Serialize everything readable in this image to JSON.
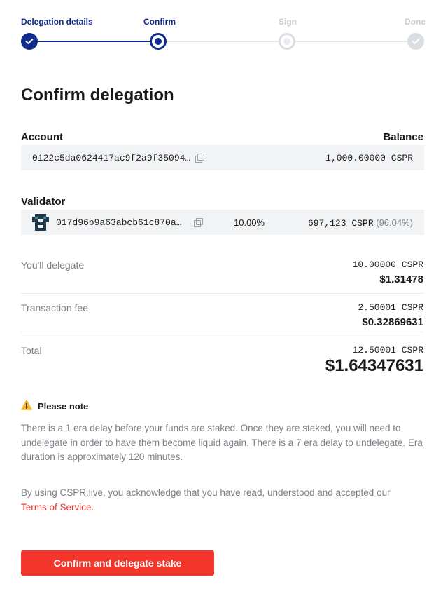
{
  "stepper": {
    "steps": [
      {
        "label": "Delegation details",
        "state": "complete"
      },
      {
        "label": "Confirm",
        "state": "current"
      },
      {
        "label": "Sign",
        "state": "pending"
      },
      {
        "label": "Done",
        "state": "pending"
      }
    ]
  },
  "page_title": "Confirm delegation",
  "account": {
    "label": "Account",
    "balance_label": "Balance",
    "public_key": "0122c5da0624417ac9f2a9f35094…",
    "balance": "1,000.00000 CSPR"
  },
  "validator": {
    "label": "Validator",
    "public_key": "017d96b9a63abcb61c870a…",
    "fee": "10.00%",
    "stake": "697,123 CSPR",
    "stake_share": "(96.04%)"
  },
  "summary": {
    "delegate": {
      "label": "You'll delegate",
      "amount": "10.00000 CSPR",
      "fiat": "$1.31478"
    },
    "fee": {
      "label": "Transaction fee",
      "amount": "2.50001 CSPR",
      "fiat": "$0.32869631"
    },
    "total": {
      "label": "Total",
      "amount": "12.50001 CSPR",
      "fiat": "$1.64347631"
    }
  },
  "note": {
    "title": "Please note",
    "body": "There is a 1 era delay before your funds are staked. Once they are staked, you will need to undelegate in order to have them become liquid again. There is a 7 era delay to undelegate. Era duration is approximately 120 minutes."
  },
  "terms": {
    "text": "By using CSPR.live, you acknowledge that you have read, understood and accepted our",
    "link": "Terms of Service."
  },
  "cta_label": "Confirm and delegate stake",
  "colors": {
    "primary": "#0f2b8c",
    "accent": "#f4352b",
    "warning": "#f5b52e"
  }
}
